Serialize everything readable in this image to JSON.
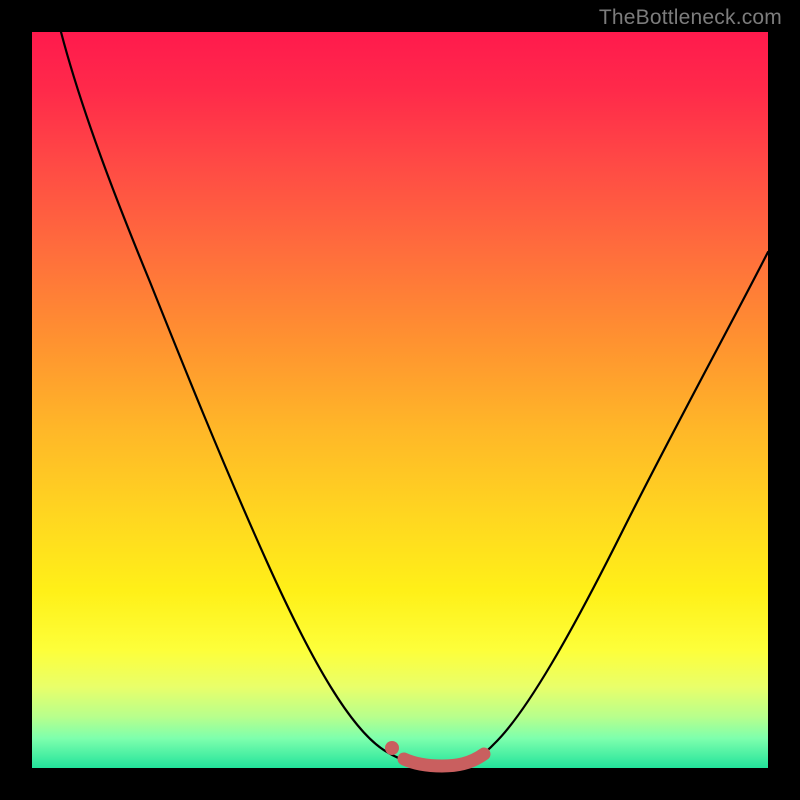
{
  "watermark": "TheBottleneck.com",
  "colors": {
    "accent_stroke": "#c95f5f",
    "curve_stroke": "#000000",
    "gradient_top": "#ff1a4d",
    "gradient_bottom": "#22e39b",
    "background": "#000000"
  },
  "chart_data": {
    "type": "line",
    "title": "",
    "xlabel": "",
    "ylabel": "",
    "xlim": [
      0,
      100
    ],
    "ylim": [
      0,
      100
    ],
    "grid": false,
    "series": [
      {
        "name": "bottleneck-curve",
        "x": [
          4,
          8,
          12,
          16,
          20,
          24,
          28,
          32,
          36,
          40,
          44,
          48,
          50,
          52,
          54,
          56,
          58,
          60,
          62,
          66,
          70,
          74,
          78,
          82,
          86,
          90,
          94,
          98,
          100
        ],
        "y": [
          100,
          92,
          83,
          74,
          65,
          56,
          48,
          40,
          32,
          25,
          18,
          11,
          7,
          4,
          2,
          1,
          1,
          2,
          4,
          10,
          18,
          26,
          34,
          42,
          50,
          57,
          64,
          70,
          73
        ]
      },
      {
        "name": "min-region",
        "x": [
          50,
          52,
          54,
          56,
          58,
          60,
          62
        ],
        "y": [
          4,
          2,
          1,
          1,
          1,
          2,
          4
        ]
      }
    ],
    "annotations": [
      {
        "name": "min-start-dot",
        "x": 50,
        "y": 4
      }
    ]
  }
}
